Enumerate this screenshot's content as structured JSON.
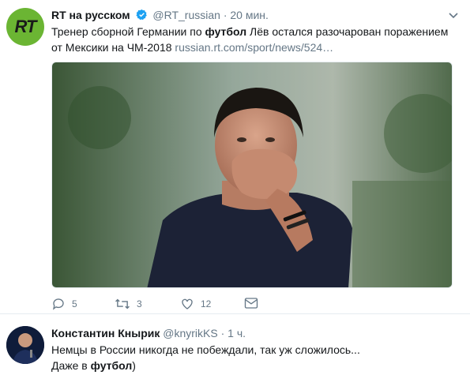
{
  "tweet": {
    "author_name": "RT на русском",
    "handle": "@RT_russian",
    "separator": "·",
    "time": "20 мин.",
    "avatar_text": "RT",
    "text_part1": "Тренер сборной Германии по ",
    "text_bold": "футбол",
    "text_part2": " Лёв остался разочарован поражением от Мексики на ЧМ-2018 ",
    "link": "russian.rt.com/sport/news/524…",
    "actions": {
      "reply_count": "5",
      "retweet_count": "3",
      "like_count": "12"
    }
  },
  "reply": {
    "author_name": "Константин Кнырик",
    "handle": "@knyrikKS",
    "separator": "·",
    "time": "1 ч.",
    "line1": "Немцы в России никогда не побеждали, так уж сложилось...",
    "line2_part1": "Даже в ",
    "line2_bold": "футбол",
    "line2_part2": ")"
  },
  "colors": {
    "accent": "#1da1f2",
    "muted": "#657786",
    "rt_green": "#6bb533"
  }
}
